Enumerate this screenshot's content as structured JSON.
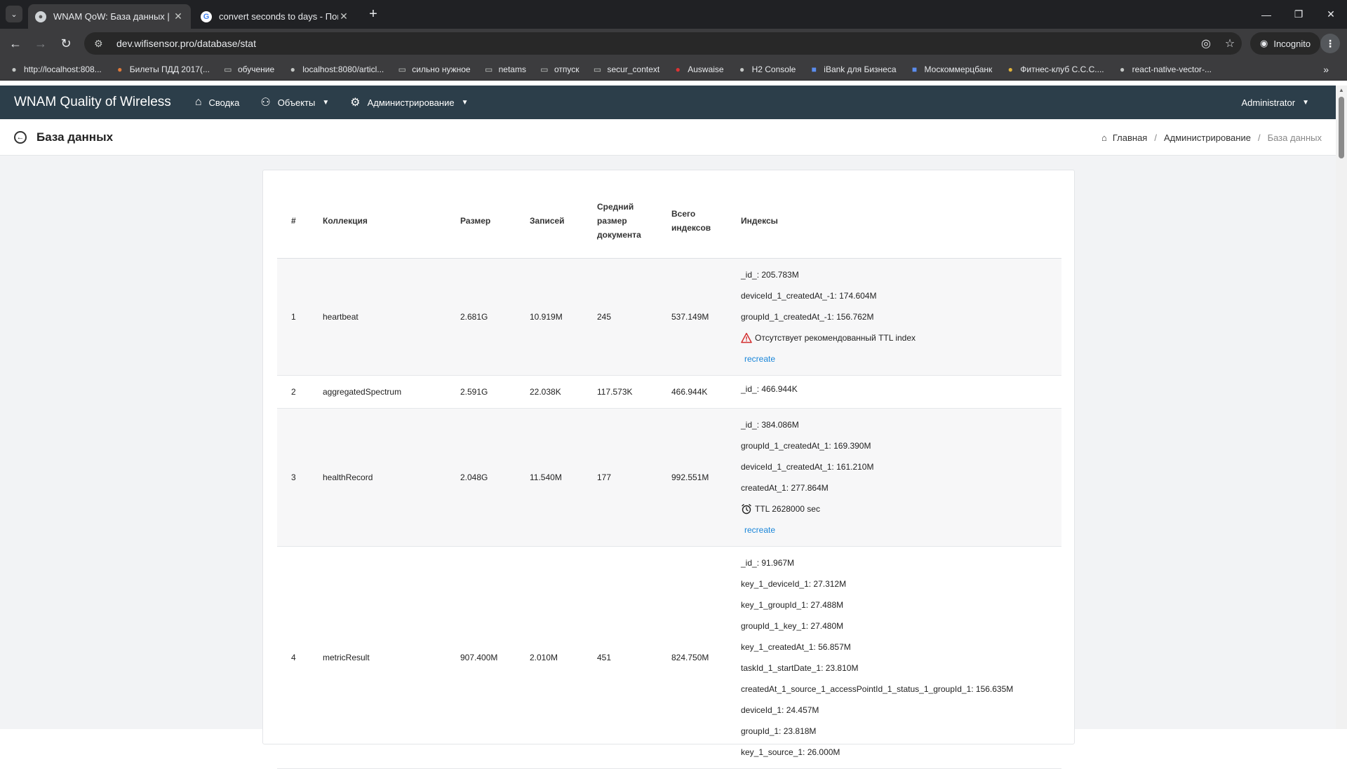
{
  "browser": {
    "tabs": [
      {
        "title": "WNAM QoW: База данных |",
        "active": true
      },
      {
        "title": "convert seconds to days - Поис",
        "active": false
      }
    ],
    "url": "dev.wifisensor.pro/database/stat",
    "incognito_label": "Incognito",
    "bookmarks": [
      {
        "label": "http://localhost:808...",
        "icon": "globe-icon"
      },
      {
        "label": "Билеты ПДД 2017(...",
        "icon": "site-icon"
      },
      {
        "label": "обучение",
        "icon": "folder-icon"
      },
      {
        "label": "localhost:8080/articl...",
        "icon": "globe-icon"
      },
      {
        "label": "сильно нужное",
        "icon": "folder-icon"
      },
      {
        "label": "netams",
        "icon": "folder-icon"
      },
      {
        "label": "отпуск",
        "icon": "folder-icon"
      },
      {
        "label": "secur_context",
        "icon": "folder-icon"
      },
      {
        "label": "Auswaise",
        "icon": "flag-icon"
      },
      {
        "label": "H2 Console",
        "icon": "globe-icon"
      },
      {
        "label": "iBank для Бизнеса",
        "icon": "bank-icon"
      },
      {
        "label": "Москоммерцбанк",
        "icon": "bank-icon"
      },
      {
        "label": "Фитнес-клуб С.С.С....",
        "icon": "site-icon"
      },
      {
        "label": "react-native-vector-...",
        "icon": "globe-icon"
      }
    ]
  },
  "app": {
    "brand": "WNAM Quality of Wireless",
    "menu": [
      {
        "label": "Сводка",
        "icon": "home-icon",
        "dropdown": false
      },
      {
        "label": "Объекты",
        "icon": "objects-icon",
        "dropdown": true
      },
      {
        "label": "Администрирование",
        "icon": "gear-icon",
        "dropdown": true
      }
    ],
    "user": "Administrator"
  },
  "page": {
    "title": "База данных",
    "breadcrumb": [
      "Главная",
      "Администрирование",
      "База данных"
    ]
  },
  "table": {
    "headers": {
      "num": "#",
      "collection": "Коллекция",
      "size": "Размер",
      "count": "Записей",
      "avg_size": "Средний размер документа",
      "total_index": "Всего индексов",
      "indexes": "Индексы"
    },
    "rows": [
      {
        "num": "1",
        "collection": "heartbeat",
        "size": "2.681G",
        "count": "10.919M",
        "avg": "245",
        "total": "537.149M",
        "indexes": [
          "_id_: 205.783M",
          "deviceId_1_createdAt_-1: 174.604M",
          "groupId_1_createdAt_-1: 156.762M"
        ],
        "warning": "Отсутствует рекомендованный TTL index",
        "action": "recreate"
      },
      {
        "num": "2",
        "collection": "aggregatedSpectrum",
        "size": "2.591G",
        "count": "22.038K",
        "avg": "117.573K",
        "total": "466.944K",
        "indexes": [
          "_id_: 466.944K"
        ]
      },
      {
        "num": "3",
        "collection": "healthRecord",
        "size": "2.048G",
        "count": "11.540M",
        "avg": "177",
        "total": "992.551M",
        "indexes": [
          "_id_: 384.086M",
          "groupId_1_createdAt_1: 169.390M",
          "deviceId_1_createdAt_1: 161.210M",
          "createdAt_1: 277.864M"
        ],
        "ttl": "TTL 2628000 sec",
        "action": "recreate"
      },
      {
        "num": "4",
        "collection": "metricResult",
        "size": "907.400M",
        "count": "2.010M",
        "avg": "451",
        "total": "824.750M",
        "indexes": [
          "_id_: 91.967M",
          "key_1_deviceId_1: 27.312M",
          "key_1_groupId_1: 27.488M",
          "groupId_1_key_1: 27.480M",
          "key_1_createdAt_1: 56.857M",
          "taskId_1_startDate_1: 23.810M",
          "createdAt_1_source_1_accessPointId_1_status_1_groupId_1: 156.635M",
          "deviceId_1: 24.457M",
          "groupId_1: 23.818M",
          "key_1_source_1: 26.000M"
        ]
      }
    ]
  }
}
